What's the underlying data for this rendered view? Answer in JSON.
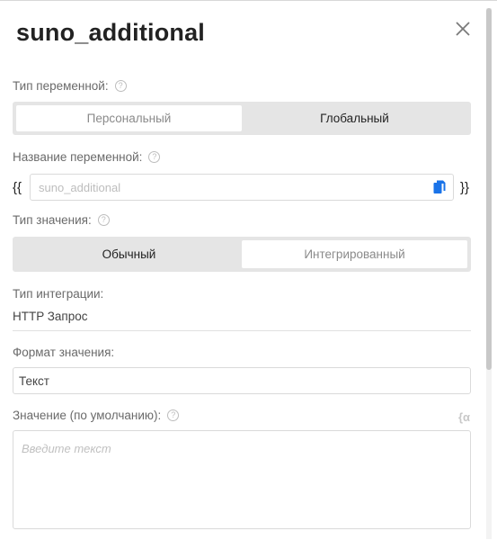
{
  "dialog": {
    "title": "suno_additional"
  },
  "variable_type": {
    "label": "Тип переменной:",
    "help": "?",
    "options": [
      "Персональный",
      "Глобальный"
    ],
    "selected": "Персональный"
  },
  "variable_name": {
    "label": "Название переменной:",
    "help": "?",
    "open_brace": "{{",
    "close_brace": "}}",
    "value": "suno_additional"
  },
  "value_type": {
    "label": "Тип значения:",
    "help": "?",
    "options": [
      "Обычный",
      "Интегрированный"
    ],
    "selected": "Интегрированный"
  },
  "integration_type": {
    "label": "Тип интеграции:",
    "value": "HTTP Запрос"
  },
  "value_format": {
    "label": "Формат значения:",
    "value": "Текст"
  },
  "default_value": {
    "label": "Значение (по умолчанию):",
    "help": "?",
    "insert_variable": "{α",
    "placeholder": "Введите текст"
  },
  "icons": [
    "close-icon",
    "help-icon",
    "copy-icon",
    "insert-variable-icon"
  ],
  "colors": {
    "segment_bg": "#e5e5e5",
    "accent": "#1a73e8"
  }
}
